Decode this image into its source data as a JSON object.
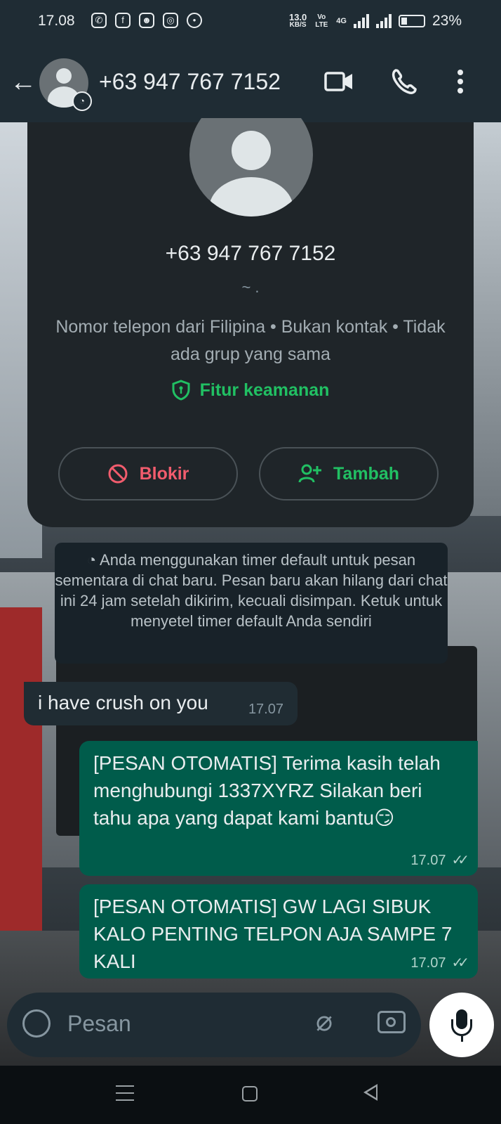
{
  "status_bar": {
    "time": "17.08",
    "net_speed_value": "13.0",
    "net_speed_unit": "KB/S",
    "volte": "Vo LTE",
    "network": "4G",
    "battery": "23%",
    "app_icons": [
      "whatsapp-icon",
      "facebook-icon",
      "app-icon",
      "instagram-icon",
      "location-icon"
    ]
  },
  "header": {
    "title": "+63 947 767 7152",
    "icons": [
      "back-arrow-icon",
      "video-call-icon",
      "voice-call-icon",
      "more-options-icon"
    ]
  },
  "profile_card": {
    "phone": "+63 947 767 7152",
    "about": "~ .",
    "info": "Nomor telepon dari Filipina • Bukan kontak • Tidak ada grup yang sama",
    "security_label": "Fitur keamanan",
    "block_label": "Blokir",
    "add_label": "Tambah"
  },
  "system_notice": {
    "text": "Anda menggunakan timer default untuk pesan sementara di chat baru. Pesan baru akan hilang dari chat ini 24 jam setelah dikirim, kecuali disimpan. Ketuk untuk menyetel timer default Anda sendiri"
  },
  "messages": [
    {
      "direction": "incoming",
      "text": "i have crush on you",
      "time": "17.07"
    },
    {
      "direction": "outgoing",
      "text": "[PESAN OTOMATIS] Terima kasih telah menghubungi 1337XYRZ Silakan beri tahu apa yang dapat kami bantu😏",
      "time": "17.07",
      "status": "read"
    },
    {
      "direction": "outgoing",
      "text": "[PESAN OTOMATIS] GW LAGI SIBUK KALO PENTING TELPON AJA SAMPE 7 KALI",
      "time": "17.07",
      "status": "read"
    }
  ],
  "composer": {
    "placeholder": "Pesan"
  },
  "colors": {
    "header": "#1f2c34",
    "outgoing_bubble": "#005c4b",
    "incoming_bubble": "#202c33",
    "accent_green": "#21c063",
    "danger_red": "#f15c6d"
  }
}
